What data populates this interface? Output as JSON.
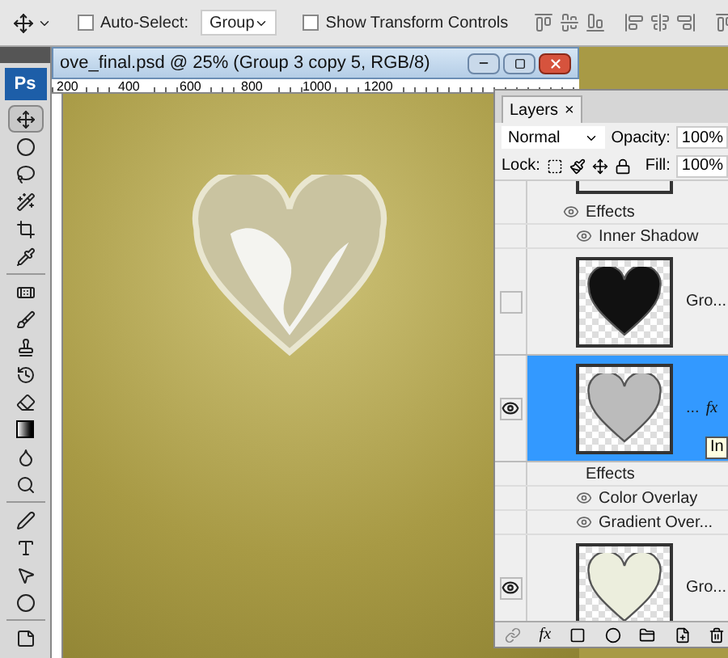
{
  "options_bar": {
    "auto_select": {
      "label": "Auto-Select:",
      "checked": false
    },
    "auto_select_target": "Group",
    "show_transform_controls": {
      "label": "Show Transform Controls",
      "checked": false
    }
  },
  "tools_panel": {
    "logo": "Ps",
    "tools": [
      {
        "kind": "move",
        "selected": true
      },
      {
        "kind": "marquee",
        "selected": false
      },
      {
        "kind": "lasso",
        "selected": false
      },
      {
        "kind": "wand",
        "selected": false
      },
      {
        "kind": "crop",
        "selected": false
      },
      {
        "kind": "eyedropper",
        "selected": false
      },
      {
        "kind": "heal",
        "selected": false
      },
      {
        "kind": "brush",
        "selected": false
      },
      {
        "kind": "stamp",
        "selected": false
      },
      {
        "kind": "history",
        "selected": false
      },
      {
        "kind": "eraser",
        "selected": false
      },
      {
        "kind": "gradient",
        "selected": false
      },
      {
        "kind": "blur",
        "selected": false
      },
      {
        "kind": "dodge",
        "selected": false
      },
      {
        "kind": "pen",
        "selected": false
      },
      {
        "kind": "type",
        "selected": false
      },
      {
        "kind": "select",
        "selected": false
      },
      {
        "kind": "shape",
        "selected": false
      },
      {
        "kind": "notes",
        "selected": false
      }
    ]
  },
  "document": {
    "title": "ove_final.psd @ 25% (Group 3 copy 5, RGB/8)",
    "ruler_labels": [
      "200",
      "400",
      "600",
      "800",
      "1000",
      "1200"
    ]
  },
  "layers_panel": {
    "tab": "Layers",
    "close": "×",
    "blend_mode": "Normal",
    "opacity_label": "Opacity:",
    "opacity": "100%",
    "lock_label": "Lock:",
    "fill_label": "Fill:",
    "fill": "100%",
    "rows": [
      {
        "kind": "layer_cut"
      },
      {
        "kind": "effects",
        "label": "Effects",
        "visible": true
      },
      {
        "kind": "effect",
        "label": "Inner Shadow",
        "visible": true
      },
      {
        "kind": "layer",
        "name": "Gro...",
        "fx": "",
        "visible": false,
        "selected": false,
        "color": "#111111"
      },
      {
        "kind": "layer",
        "name": "...",
        "fx": "fx",
        "visible": true,
        "selected": true,
        "color": "#bbbbbb"
      },
      {
        "kind": "effects",
        "label": "Effects",
        "visible": false
      },
      {
        "kind": "effect",
        "label": "Color Overlay",
        "visible": true
      },
      {
        "kind": "effect",
        "label": "Gradient Over...",
        "visible": true
      },
      {
        "kind": "layer",
        "name": "Gro...",
        "fx": "",
        "visible": true,
        "selected": false,
        "color": "#eceedd"
      }
    ],
    "footer_fx": "fx",
    "tooltip": "In"
  }
}
